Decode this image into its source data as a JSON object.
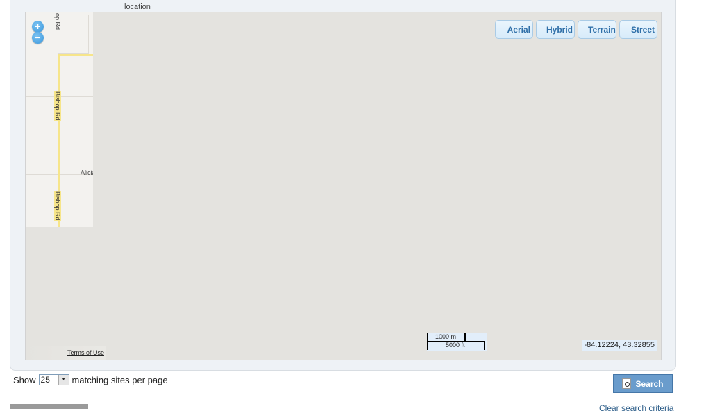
{
  "location_label": "location",
  "map": {
    "layers": [
      "Aerial",
      "Hybrid",
      "Terrain",
      "Street"
    ],
    "zoom_in_label": "+",
    "zoom_out_label": "−",
    "roads": [
      "Bishop Rd",
      "Bishop Rd",
      "op Rd"
    ],
    "place": "Alicia",
    "terms_label": "Terms of Use",
    "scale_metric": "1000 m",
    "scale_imperial": "5000 ft",
    "coordinates": "-84.12224, 43.32855"
  },
  "pager": {
    "show_label": "Show",
    "per_page_value": "25",
    "suffix_label": "matching sites per page"
  },
  "search_label": "Search",
  "clear_label": "Clear search criteria"
}
